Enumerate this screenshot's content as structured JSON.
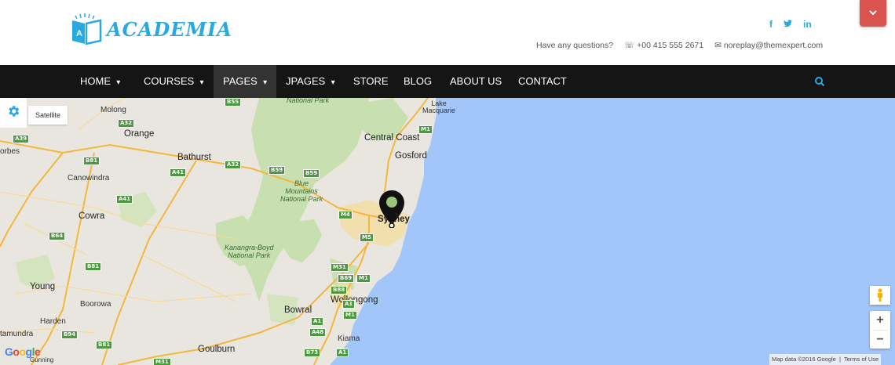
{
  "header": {
    "logo_text": "ACADEMIA",
    "logo_letter": "A",
    "social": [
      "f",
      "t",
      "in"
    ],
    "contact_question": "Have any questions?",
    "contact_phone": "+00 415 555 2671",
    "contact_email": "noreplay@themexpert.com"
  },
  "nav": {
    "items": [
      {
        "label": "HOME",
        "caret": "▾"
      },
      {
        "label": "COURSES",
        "caret": "▾"
      },
      {
        "label": "PAGES",
        "caret": "▾"
      },
      {
        "label": "JPAGES",
        "caret": "▾"
      },
      {
        "label": "STORE"
      },
      {
        "label": "BLOG"
      },
      {
        "label": "ABOUT US"
      },
      {
        "label": "CONTACT"
      }
    ],
    "active": "PAGES"
  },
  "map": {
    "satellite_label": "Satellite",
    "zoom_in": "+",
    "zoom_out": "−",
    "attribution_data": "Map data ©2016 Google",
    "attribution_terms": "Terms of Use",
    "google": "Google",
    "labels": {
      "molong": "Molong",
      "orange": "Orange",
      "orbes": "orbes",
      "bathurst": "Bathurst",
      "canowindra": "Canowindra",
      "cowra": "Cowra",
      "young": "Young",
      "boorowa": "Boorowa",
      "harden": "Harden",
      "tamundra": "tamundra",
      "goulburn": "Goulburn",
      "bowral": "Bowral",
      "kiama": "Kiama",
      "wollongong": "Wollongong",
      "sydney": "Sydney",
      "gosford": "Gosford",
      "central_coast": "Central Coast",
      "lake_macquarie": "Lake\nMacquarie",
      "blue_mountains": "Blue\nMountains\nNational Park",
      "kanangra": "Kanangra-Boyd\nNational Park",
      "national_park": "National Park",
      "gunning": "Gunning"
    },
    "shields": [
      "B55",
      "A32",
      "A39",
      "B81",
      "A41",
      "A32",
      "B59",
      "B59",
      "A41",
      "B64",
      "B81",
      "M1",
      "M4",
      "M5",
      "M31",
      "B69",
      "M1",
      "B88",
      "A1",
      "M1",
      "A1",
      "A48",
      "B73",
      "A1",
      "B81",
      "B94",
      "M31"
    ]
  },
  "colors": {
    "accent": "#29a9e1",
    "nav_bg": "#151515",
    "nav_active": "#333333",
    "water": "#a3c6fa",
    "land": "#e8e6df",
    "park": "#c8dfb0",
    "dropdown": "#d9534f"
  },
  "icons": {
    "dropdown": "chevron-down-icon",
    "phone": "phone-icon",
    "email": "envelope-icon",
    "search": "search-icon",
    "settings": "gear-icon",
    "marker": "map-marker-icon",
    "pegman": "pegman-icon"
  }
}
